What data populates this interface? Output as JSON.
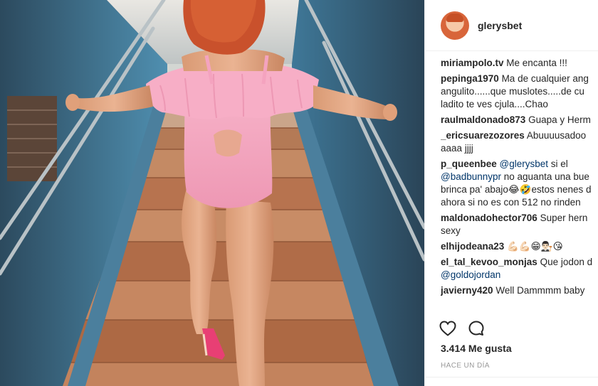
{
  "post": {
    "username": "glerysbet",
    "likes": "3.414 Me gusta",
    "timestamp": "HACE UN DÍA"
  },
  "icons": {
    "heart": "heart-icon",
    "comment": "comment-bubble-icon"
  },
  "comments": [
    {
      "user": "miriampolo.tv",
      "lines": [
        "Me encanta !!!"
      ]
    },
    {
      "user": "pepinga1970",
      "lines": [
        "Ma de cualquier ang",
        "angulito......que muslotes.....de cu",
        "ladito te ves cjula....Chao"
      ]
    },
    {
      "user": "raulmaldonado873",
      "lines": [
        "Guapa y Herm"
      ]
    },
    {
      "user": "_ericsuarezozores",
      "lines": [
        "Abuuuusadoo",
        "aaaa jjjj"
      ]
    },
    {
      "user": "p_queenbee",
      "mention1": "@glerysbet",
      "text1": " si el",
      "mention2": "@badbunnypr",
      "text2": " no aguanta una bue",
      "lines": [
        "brinca pa' abajo😂🤣estos nenes d",
        "ahora si no es con 512 no rinden"
      ]
    },
    {
      "user": "maldonadohector706",
      "lines": [
        "Super hern",
        "sexy"
      ]
    },
    {
      "user": "elhijodeana23",
      "lines": [
        "💪🏻💪🏻😁👨🏻‍⚖️😘"
      ]
    },
    {
      "user": "el_tal_kevoo_monjas",
      "lines": [
        "Que jodon d"
      ],
      "mention": "@goldojordan"
    },
    {
      "user": "javierny420",
      "lines": [
        "Well Dammmm baby"
      ]
    }
  ],
  "colors": {
    "pink_swimsuit": "#f4a3bf",
    "stair_tile": "#b9744f",
    "wall_blue": "#3f6c88",
    "mention": "#003569",
    "muted": "#999999"
  }
}
